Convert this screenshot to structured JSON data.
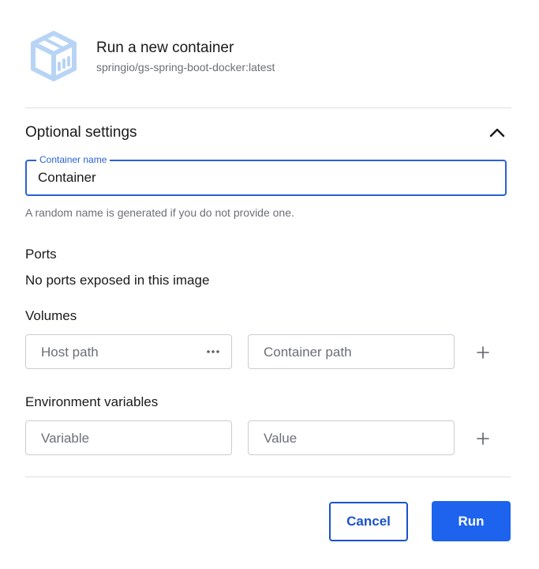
{
  "header": {
    "title": "Run a new container",
    "image_name": "springio/gs-spring-boot-docker:latest",
    "logo_icon": "container-box-icon"
  },
  "optional_settings": {
    "title": "Optional settings",
    "expanded": true,
    "collapse_icon": "chevron-up-icon"
  },
  "container_name": {
    "label": "Container name",
    "value": "Container",
    "helper": "A random name is generated if you do not provide one."
  },
  "ports": {
    "label": "Ports",
    "message": "No ports exposed in this image"
  },
  "volumes": {
    "label": "Volumes",
    "host_placeholder": "Host path",
    "container_placeholder": "Container path",
    "browse_icon": "more-horizontal-icon",
    "add_icon": "plus-icon"
  },
  "env": {
    "label": "Environment variables",
    "variable_placeholder": "Variable",
    "value_placeholder": "Value",
    "add_icon": "plus-icon"
  },
  "actions": {
    "cancel_label": "Cancel",
    "run_label": "Run"
  },
  "colors": {
    "accent": "#1d63ed",
    "focus_border": "#2a62d6",
    "cancel_text": "#1b52c7",
    "logo": "#b8d4f5"
  }
}
